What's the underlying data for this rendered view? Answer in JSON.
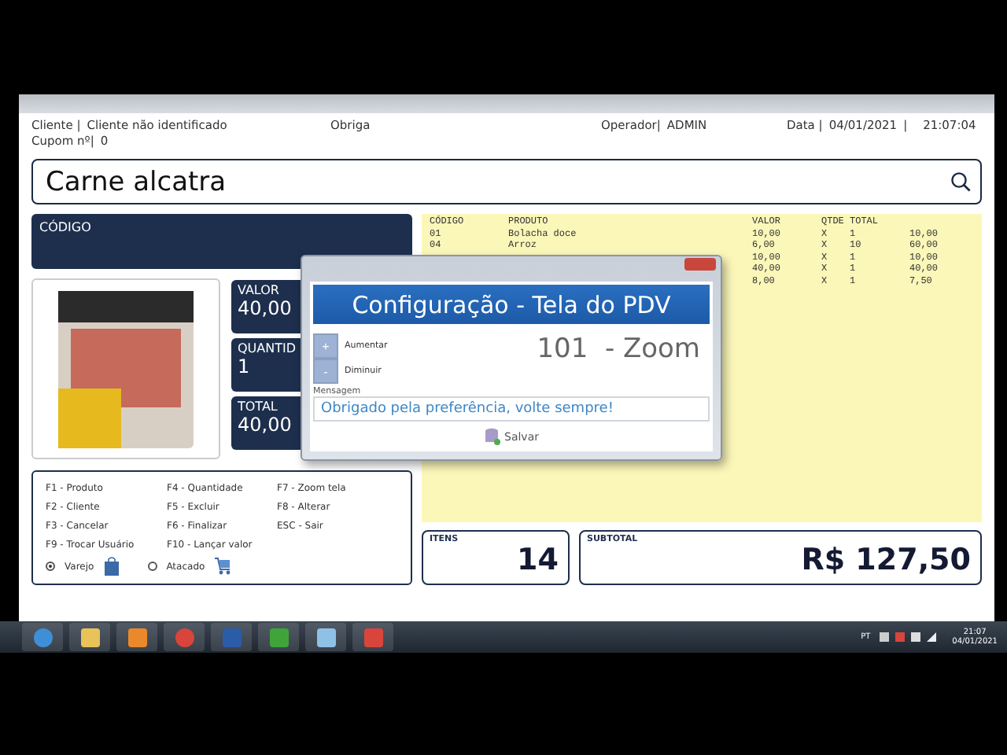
{
  "header": {
    "client_label": "Cliente |",
    "client": "Cliente não identificado",
    "company": "Obriga",
    "operator_label": "Operador|",
    "operator": "ADMIN",
    "date_label": "Data |",
    "date": "04/01/2021",
    "separator": "|",
    "time": "21:07:04",
    "coupon_label": "Cupom nº|",
    "coupon": "0"
  },
  "search": {
    "value": "Carne alcatra"
  },
  "code_panel": {
    "label": "CÓDIGO"
  },
  "value_boxes": [
    {
      "label": "VALOR",
      "value": "40,00"
    },
    {
      "label": "QUANTID",
      "value": "1"
    },
    {
      "label": "TOTAL",
      "value": "40,00"
    }
  ],
  "shortcuts": [
    "F1 - Produto",
    "F4 - Quantidade",
    "F7 - Zoom tela",
    "F2 - Cliente",
    "F5 - Excluir",
    "F8 - Alterar",
    "F3 - Cancelar",
    "F6 - Finalizar",
    "ESC - Sair",
    "F9 - Trocar Usuário",
    "F10 - Lançar valor"
  ],
  "sale_mode": [
    {
      "label": "Varejo",
      "selected": true,
      "kind": "bag"
    },
    {
      "label": "Atacado",
      "selected": false,
      "kind": "cart"
    }
  ],
  "items_table": {
    "columns": [
      "CÓDIGO",
      "PRODUTO",
      "VALOR",
      "QTDE",
      "TOTAL"
    ],
    "rows": [
      {
        "code": "01",
        "product": "Bolacha doce",
        "price": "10,00",
        "times": "X",
        "qty": "1",
        "total": "10,00"
      },
      {
        "code": "04",
        "product": "Arroz",
        "price": "6,00",
        "times": "X",
        "qty": "10",
        "total": "60,00"
      },
      {
        "price": "10,00",
        "times": "X",
        "qty": "1",
        "total": "10,00"
      },
      {
        "price": "40,00",
        "times": "X",
        "qty": "1",
        "total": "40,00"
      },
      {
        "price": "8,00",
        "times": "X",
        "qty": "1",
        "total": "7,50"
      }
    ]
  },
  "summary": {
    "items_label": "ITENS",
    "items": "14",
    "subtotal_label": "SUBTOTAL",
    "subtotal": "R$ 127,50"
  },
  "dialog": {
    "title": "Configuração - Tela do PDV",
    "increase_button": "+",
    "increase": "Aumentar",
    "decrease_button": "-",
    "decrease": "Diminuir",
    "zoom": "101  - Zoom",
    "message_label": "Mensagem",
    "message": "Obrigado pela preferência, volte sempre!",
    "save": "Salvar"
  },
  "taskbar": {
    "language": "PT",
    "time": "21:07",
    "date": "04/01/2021"
  }
}
